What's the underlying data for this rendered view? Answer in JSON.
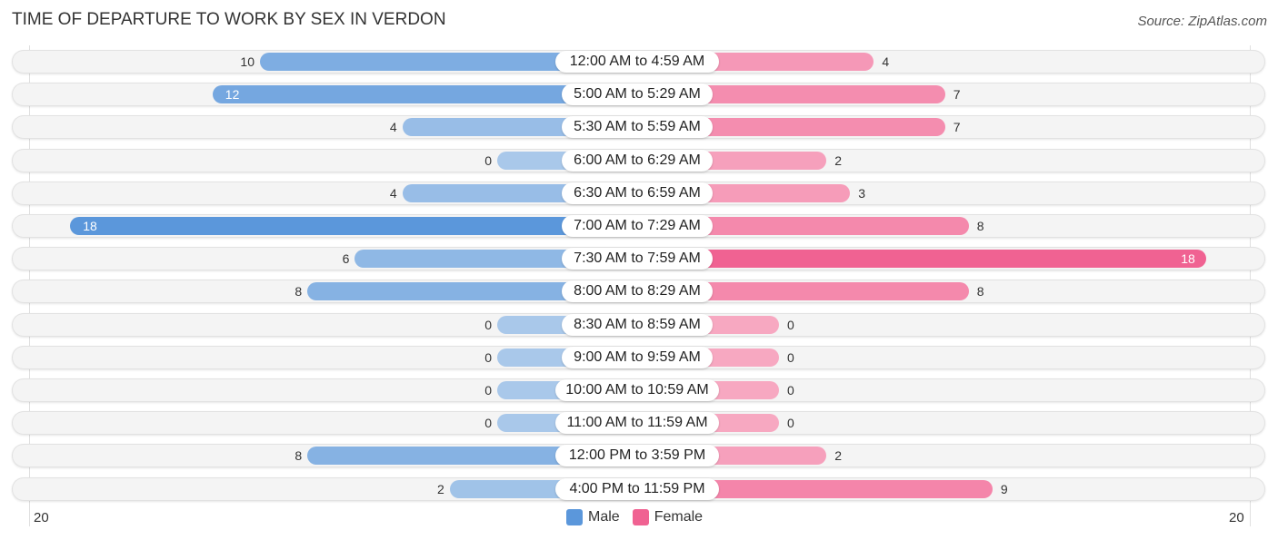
{
  "title": "TIME OF DEPARTURE TO WORK BY SEX IN VERDON",
  "source": "Source: ZipAtlas.com",
  "colors": {
    "male": "#6fa3dc",
    "male_light": "#a9c8ea",
    "male_strong": "#5b97db",
    "female": "#f48fb1",
    "female_light": "#f7a8c1",
    "female_strong": "#f06292"
  },
  "chart_data": {
    "type": "bar",
    "orientation": "horizontal-diverging",
    "title": "TIME OF DEPARTURE TO WORK BY SEX IN VERDON",
    "categories": [
      "12:00 AM to 4:59 AM",
      "5:00 AM to 5:29 AM",
      "5:30 AM to 5:59 AM",
      "6:00 AM to 6:29 AM",
      "6:30 AM to 6:59 AM",
      "7:00 AM to 7:29 AM",
      "7:30 AM to 7:59 AM",
      "8:00 AM to 8:29 AM",
      "8:30 AM to 8:59 AM",
      "9:00 AM to 9:59 AM",
      "10:00 AM to 10:59 AM",
      "11:00 AM to 11:59 AM",
      "12:00 PM to 3:59 PM",
      "4:00 PM to 11:59 PM"
    ],
    "series": [
      {
        "name": "Male",
        "values": [
          10,
          12,
          4,
          0,
          4,
          18,
          6,
          8,
          0,
          0,
          0,
          0,
          8,
          2
        ]
      },
      {
        "name": "Female",
        "values": [
          4,
          7,
          7,
          2,
          3,
          8,
          18,
          8,
          0,
          0,
          0,
          0,
          2,
          9
        ]
      }
    ],
    "xlim": [
      20,
      20
    ],
    "axis_ticks": {
      "left": "20",
      "right": "20"
    },
    "legend": {
      "position": "bottom-center",
      "entries": [
        "Male",
        "Female"
      ]
    },
    "grid": false
  }
}
